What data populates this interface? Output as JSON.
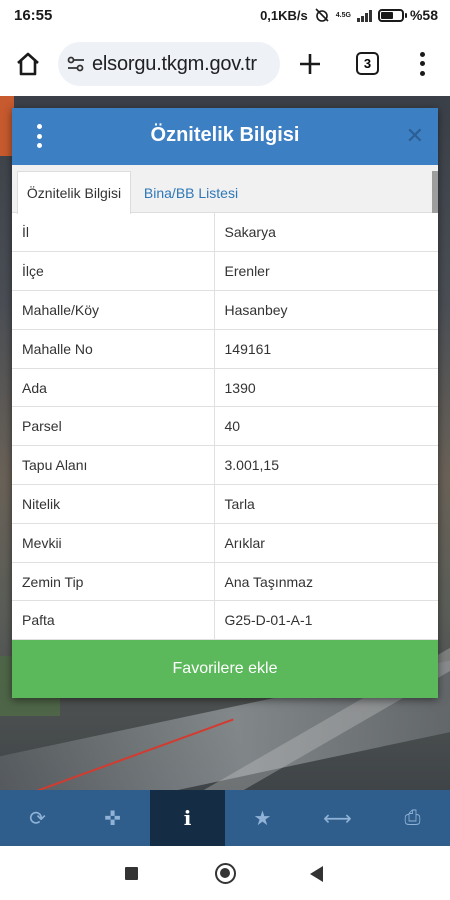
{
  "status": {
    "time": "16:55",
    "speed": "0,1KB/s",
    "network": "4.5G",
    "battery": "%58",
    "battery_level": 0.58
  },
  "browser": {
    "url": "elsorgu.tkgm.gov.tr",
    "tab_count": "3",
    "icons": {
      "home": "home-icon",
      "site_settings": "tune-icon",
      "new_tab": "plus-icon",
      "menu": "more-vert-icon"
    }
  },
  "modal": {
    "title": "Öznitelik Bilgisi",
    "close": "✕",
    "tabs": [
      {
        "label": "Öznitelik Bilgisi",
        "active": true
      },
      {
        "label": "Bina/BB Listesi",
        "active": false
      }
    ],
    "rows": [
      {
        "key": "İl",
        "value": "Sakarya"
      },
      {
        "key": "İlçe",
        "value": "Erenler"
      },
      {
        "key": "Mahalle/Köy",
        "value": "Hasanbey"
      },
      {
        "key": "Mahalle No",
        "value": "149161"
      },
      {
        "key": "Ada",
        "value": "1390"
      },
      {
        "key": "Parsel",
        "value": "40"
      },
      {
        "key": "Tapu Alanı",
        "value": "3.001,15"
      },
      {
        "key": "Nitelik",
        "value": "Tarla"
      },
      {
        "key": "Mevkii",
        "value": "Arıklar"
      },
      {
        "key": "Zemin Tip",
        "value": "Ana Taşınmaz"
      },
      {
        "key": "Pafta",
        "value": "G25-D-01-A-1"
      }
    ],
    "favorite_button": "Favorilere ekle"
  },
  "toolbar": {
    "tools": [
      {
        "name": "refresh-icon",
        "glyph": "⟳"
      },
      {
        "name": "crosshair-icon",
        "glyph": "✜"
      },
      {
        "name": "info-icon",
        "glyph": "i",
        "active": true
      },
      {
        "name": "star-icon",
        "glyph": "★"
      },
      {
        "name": "measure-icon",
        "glyph": "⟷"
      },
      {
        "name": "print-icon",
        "glyph": "⎙"
      }
    ]
  },
  "colors": {
    "header": "#3d7fc3",
    "favorite": "#5bb85b",
    "toolbar": "#2f5e8c",
    "toolbar_active": "#152c45",
    "tab_link": "#2e78b8"
  }
}
